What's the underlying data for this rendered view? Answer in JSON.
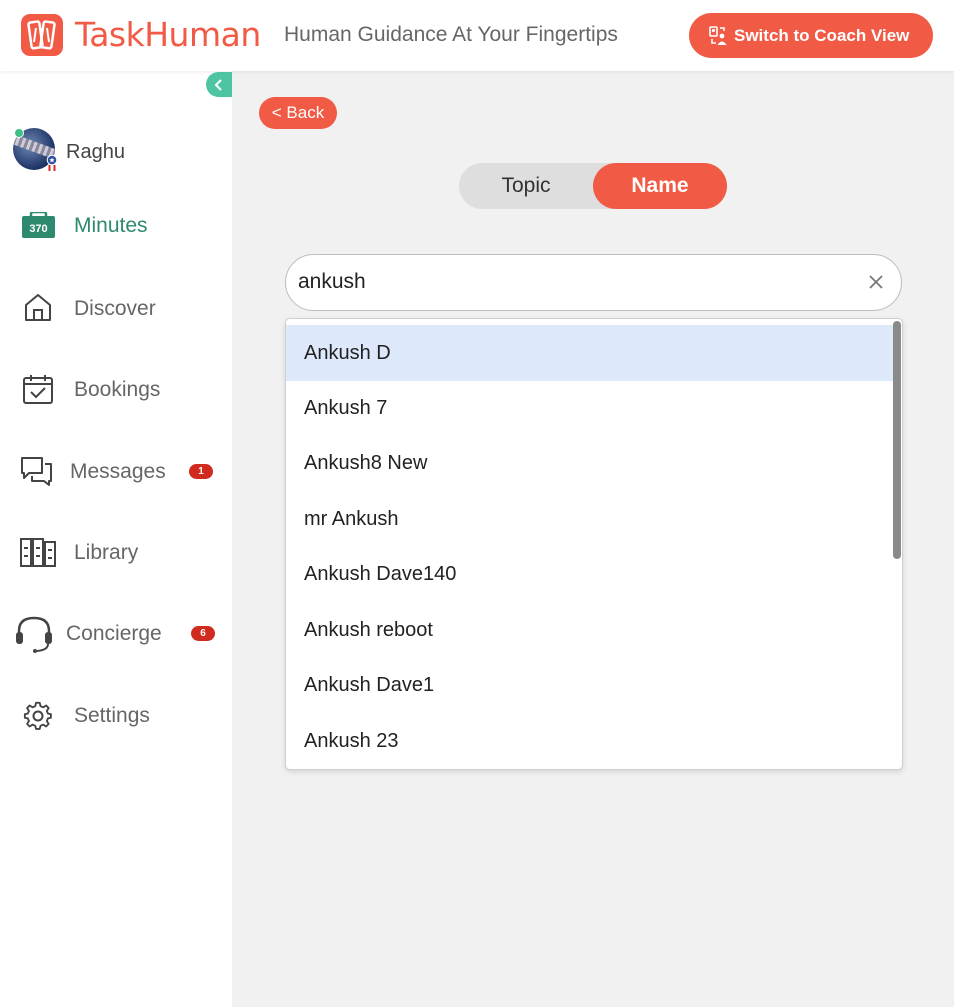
{
  "header": {
    "brand": "TaskHuman",
    "tagline": "Human Guidance At Your Fingertips",
    "coach_button": "Switch to Coach View"
  },
  "sidebar": {
    "user_name": "Raghu",
    "minutes_count": "370",
    "minutes_label": "Minutes",
    "items": [
      {
        "label": "Discover",
        "icon": "home-icon"
      },
      {
        "label": "Bookings",
        "icon": "calendar-check-icon"
      },
      {
        "label": "Messages",
        "icon": "chat-icon",
        "badge": "1"
      },
      {
        "label": "Library",
        "icon": "library-icon"
      },
      {
        "label": "Concierge",
        "icon": "headset-icon",
        "badge": "6"
      },
      {
        "label": "Settings",
        "icon": "gear-icon"
      }
    ]
  },
  "main": {
    "back_label": "< Back",
    "toggle": {
      "topic": "Topic",
      "name": "Name",
      "selected": "Name"
    },
    "search": {
      "value": "ankush"
    },
    "results": [
      "Ankush D",
      "Ankush 7",
      "Ankush8 New",
      "mr Ankush",
      "Ankush Dave140",
      "Ankush reboot",
      "Ankush Dave1",
      "Ankush 23"
    ],
    "highlighted_index": 0
  },
  "colors": {
    "brand": "#f15a45",
    "accent_green": "#2e8a6f",
    "collapse_button": "#4dc5a3",
    "badge": "#d12b1f",
    "highlight": "#dde8fb"
  }
}
